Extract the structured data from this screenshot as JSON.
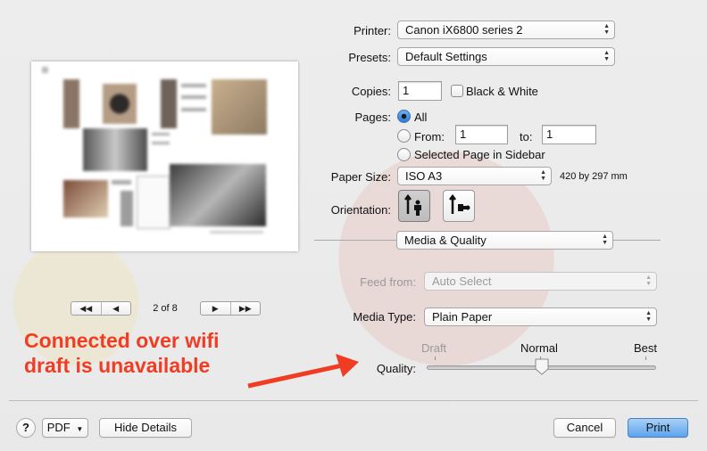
{
  "printer": {
    "label": "Printer:",
    "value": "Canon iX6800 series 2"
  },
  "presets": {
    "label": "Presets:",
    "value": "Default Settings"
  },
  "copies": {
    "label": "Copies:",
    "value": "1",
    "bw_label": "Black & White"
  },
  "pages": {
    "label": "Pages:",
    "all_label": "All",
    "from_label": "From:",
    "from_value": "1",
    "to_label": "to:",
    "to_value": "1",
    "sidebar_label": "Selected Page in Sidebar",
    "selected": "all"
  },
  "paper_size": {
    "label": "Paper Size:",
    "value": "ISO A3",
    "dims": "420 by 297 mm"
  },
  "orientation": {
    "label": "Orientation:",
    "selected": "portrait"
  },
  "section": {
    "value": "Media & Quality"
  },
  "feed": {
    "label": "Feed from:",
    "value": "Auto Select",
    "disabled": true
  },
  "media_type": {
    "label": "Media Type:",
    "value": "Plain Paper"
  },
  "quality": {
    "label": "Quality:",
    "draft_label": "Draft",
    "normal_label": "Normal",
    "best_label": "Best",
    "level_fraction": 0.5
  },
  "preview_nav": {
    "page_indicator": "2 of 8"
  },
  "annotation": {
    "line1": "Connected over wifi",
    "line2": "draft is unavailable",
    "color": "#f13c24"
  },
  "footer": {
    "help_label": "?",
    "pdf_label": "PDF",
    "hide_details_label": "Hide Details",
    "cancel_label": "Cancel",
    "print_label": "Print"
  }
}
